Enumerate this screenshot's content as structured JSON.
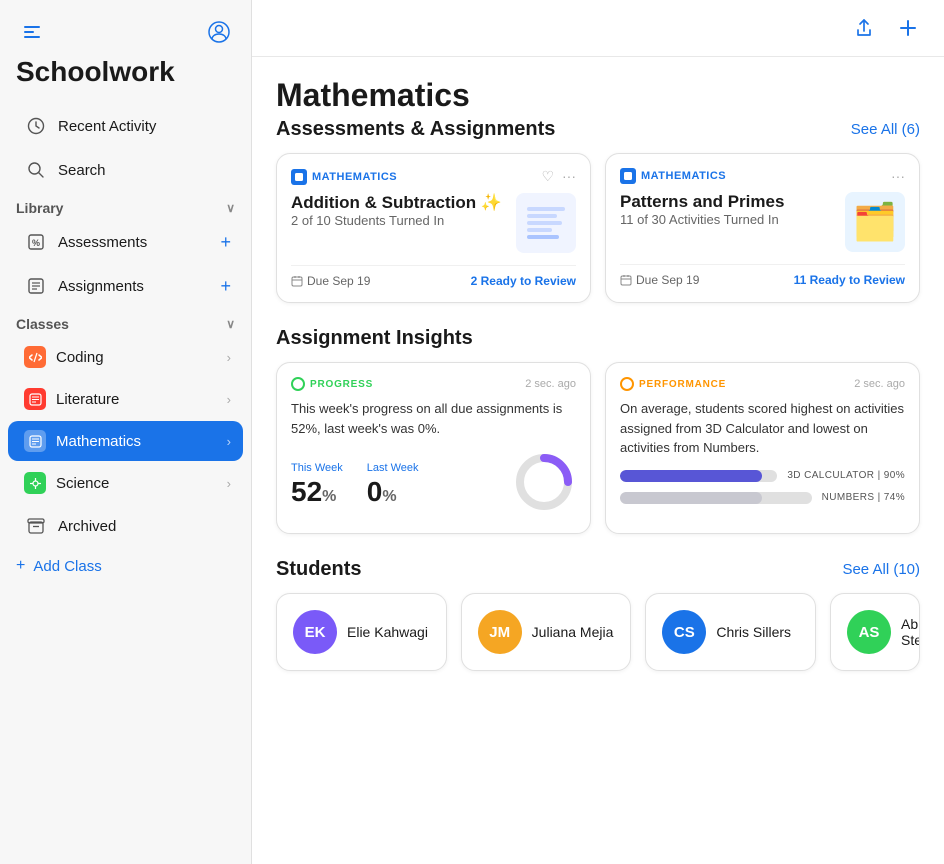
{
  "app": {
    "title": "Schoolwork"
  },
  "sidebar": {
    "toggle_icon": "sidebar",
    "profile_icon": "person.circle",
    "library_label": "Library",
    "classes_label": "Classes",
    "items_library": [
      {
        "id": "recent-activity",
        "label": "Recent Activity",
        "icon": "🕐"
      },
      {
        "id": "search",
        "label": "Search",
        "icon": "🔍"
      }
    ],
    "items_library_links": [
      {
        "id": "assessments",
        "label": "Assessments",
        "icon": "%"
      },
      {
        "id": "assignments",
        "label": "Assignments",
        "icon": "📄"
      }
    ],
    "items_classes": [
      {
        "id": "coding",
        "label": "Coding",
        "color": "#ff6b35",
        "icon": "🟧"
      },
      {
        "id": "literature",
        "label": "Literature",
        "color": "#ff3b30",
        "icon": "📊"
      },
      {
        "id": "mathematics",
        "label": "Mathematics",
        "color": "#1a73e8",
        "icon": "📋",
        "active": true
      },
      {
        "id": "science",
        "label": "Science",
        "color": "#30d158",
        "icon": "🔬"
      }
    ],
    "archived_label": "Archived",
    "add_class_label": "Add Class"
  },
  "main": {
    "page_title": "Mathematics",
    "toolbar": {
      "export_icon": "square.and.arrow.up",
      "add_icon": "plus"
    },
    "assessments_section": {
      "title": "Assessments & Assignments",
      "see_all_label": "See All (6)",
      "cards": [
        {
          "subject": "MATHEMATICS",
          "title": "Addition & Subtraction ✨",
          "subtitle": "2 of 10 Students Turned In",
          "due": "Due Sep 19",
          "review_label": "2 Ready to Review",
          "has_heart": true
        },
        {
          "subject": "MATHEMATICS",
          "title": "Patterns and Primes",
          "subtitle": "11 of 30 Activities Turned In",
          "due": "Due Sep 19",
          "review_label": "11 Ready to Review",
          "has_heart": false
        }
      ]
    },
    "insights_section": {
      "title": "Assignment Insights",
      "cards": [
        {
          "type": "progress",
          "badge": "PROGRESS",
          "time": "2 sec. ago",
          "text": "This week's progress on all due assignments is 52%, last week's was 0%.",
          "this_week_label": "This Week",
          "this_week_value": "52",
          "last_week_label": "Last Week",
          "last_week_value": "0",
          "this_week_pct": 52,
          "last_week_pct": 0
        },
        {
          "type": "performance",
          "badge": "PERFORMANCE",
          "time": "2 sec. ago",
          "text": "On average, students scored highest on activities assigned from 3D Calculator and lowest on activities from Numbers.",
          "bars": [
            {
              "label": "3D CALCULATOR | 90%",
              "value": 90
            },
            {
              "label": "NUMBERS | 74%",
              "value": 74
            }
          ]
        }
      ]
    },
    "students_section": {
      "title": "Students",
      "see_all_label": "See All (10)",
      "students": [
        {
          "initials": "EK",
          "name": "Elie Kahwagi",
          "color": "#7a5af8"
        },
        {
          "initials": "JM",
          "name": "Juliana Mejia",
          "color": "#f5a623"
        },
        {
          "initials": "CS",
          "name": "Chris Sillers",
          "color": "#1a73e8"
        },
        {
          "initials": "AS",
          "name": "Abbi Stein",
          "color": "#30d158",
          "partial": true
        }
      ]
    }
  }
}
